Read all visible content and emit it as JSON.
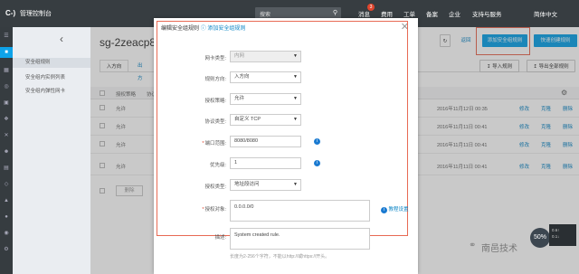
{
  "topbar": {
    "logo": "C-)",
    "console_title": "管理控制台",
    "search_placeholder": "搜索",
    "messages_badge": "3",
    "nav": [
      "消息",
      "费用",
      "工单",
      "备案",
      "企业",
      "支持与服务",
      "简体中文"
    ]
  },
  "sidebar": {
    "items": [
      "安全组规则",
      "安全组内实例列表",
      "安全组内弹性网卡"
    ]
  },
  "main": {
    "page_title": "sg-2zeacp8",
    "tabs": [
      "入方向",
      "出方向"
    ],
    "header_buttons": {
      "back": "返回",
      "add_rule": "添加安全组规则",
      "quick_add": "快速创建规则",
      "import": "导入规则",
      "export": "导出全部规则"
    },
    "table_head": [
      "授权策略",
      "协议类型"
    ],
    "rows": [
      {
        "policy": "允许",
        "time": "2016年11月12日 00:35",
        "actions": [
          "修改",
          "克隆",
          "删除"
        ]
      },
      {
        "policy": "允许",
        "time": "2016年11月11日 00:41",
        "actions": [
          "修改",
          "克隆",
          "删除"
        ]
      },
      {
        "policy": "允许",
        "time": "2016年11月11日 00:41",
        "actions": [
          "修改",
          "克隆",
          "删除"
        ]
      },
      {
        "policy": "允许",
        "time": "2016年11月11日 00:41",
        "actions": [
          "修改",
          "克隆",
          "删除"
        ]
      }
    ],
    "pager_label": "删除"
  },
  "dialog": {
    "title": "编辑安全组规则",
    "help_link": "添加安全组规则",
    "fields": {
      "nic_type": {
        "label": "网卡类型:",
        "value": "内网"
      },
      "direction": {
        "label": "规则方向:",
        "value": "入方向"
      },
      "policy": {
        "label": "授权策略:",
        "value": "允许"
      },
      "protocol": {
        "label": "协议类型:",
        "value": "自定义 TCP"
      },
      "port_range": {
        "label": "端口范围:",
        "value": "8080/8080"
      },
      "priority": {
        "label": "优先级:",
        "value": "1"
      },
      "auth_type": {
        "label": "授权类型:",
        "value": "地址段访问"
      },
      "auth_object": {
        "label": "授权对象:",
        "value": "0.0.0.0/0"
      },
      "description": {
        "label": "描述:",
        "value": "System created rule."
      }
    },
    "tutorial_link": "教程设置",
    "hint": "长度为2-256个字符，不能以http://或https://开头。"
  },
  "widgets": {
    "speed": "50%",
    "net_up": "0.6↑",
    "net_down": "0.1↓"
  },
  "watermark": "南邑技术"
}
